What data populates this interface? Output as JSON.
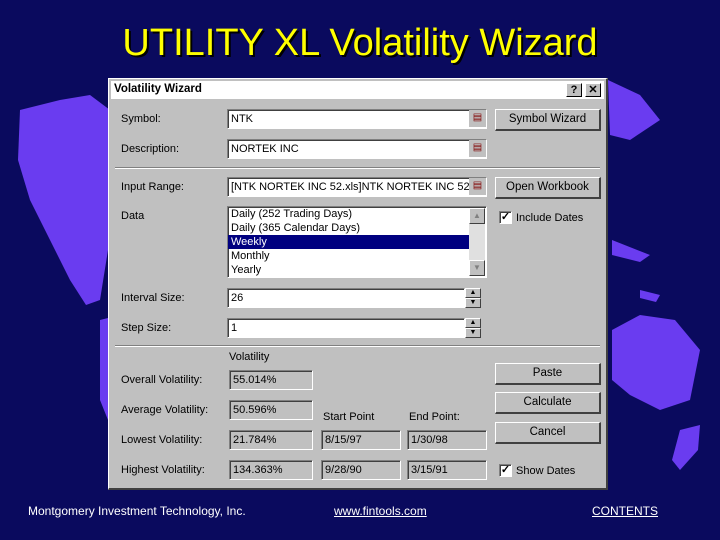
{
  "slide": {
    "title": "UTILITY XL Volatility Wizard",
    "footer_left": "Montgomery Investment Technology, Inc.",
    "footer_center": "www.fintools.com",
    "footer_right": "CONTENTS"
  },
  "colors": {
    "background": "#0a0a5e",
    "title": "#ffff00",
    "map": "#6a3cf0",
    "dialog": "#c0c0c0",
    "selection": "#000080"
  },
  "dialog": {
    "title": "Volatility Wizard",
    "help_label": "?",
    "close_label": "✕",
    "symbol_label": "Symbol:",
    "symbol_value": "NTK",
    "description_label": "Description:",
    "description_value": "NORTEK INC",
    "input_range_label": "Input Range:",
    "input_range_value": "[NTK NORTEK INC 52.xls]NTK NORTEK INC 52 (",
    "data_label": "Data",
    "data_options": [
      {
        "label": "Daily (252 Trading Days)",
        "selected": false
      },
      {
        "label": "Daily (365 Calendar Days)",
        "selected": false
      },
      {
        "label": "Weekly",
        "selected": true
      },
      {
        "label": "Monthly",
        "selected": false
      },
      {
        "label": "Yearly",
        "selected": false
      }
    ],
    "interval_label": "Interval Size:",
    "interval_value": "26",
    "step_label": "Step Size:",
    "step_value": "1",
    "volatility_header": "Volatility",
    "start_point_header": "Start Point",
    "end_point_header": "End Point:",
    "overall_label": "Overall Volatility:",
    "overall_value": "55.014%",
    "average_label": "Average Volatility:",
    "average_value": "50.596%",
    "lowest_label": "Lowest Volatility:",
    "lowest_value": "21.784%",
    "lowest_start": "8/15/97",
    "lowest_end": "1/30/98",
    "highest_label": "Highest Volatility:",
    "highest_value": "134.363%",
    "highest_start": "9/28/90",
    "highest_end": "3/15/91",
    "buttons": {
      "symbol_wizard": "Symbol Wizard",
      "open_workbook": "Open Workbook",
      "paste": "Paste",
      "calculate": "Calculate",
      "cancel": "Cancel"
    },
    "include_dates_label": "Include Dates",
    "include_dates_checked": true,
    "show_dates_label": "Show Dates",
    "show_dates_checked": true
  }
}
